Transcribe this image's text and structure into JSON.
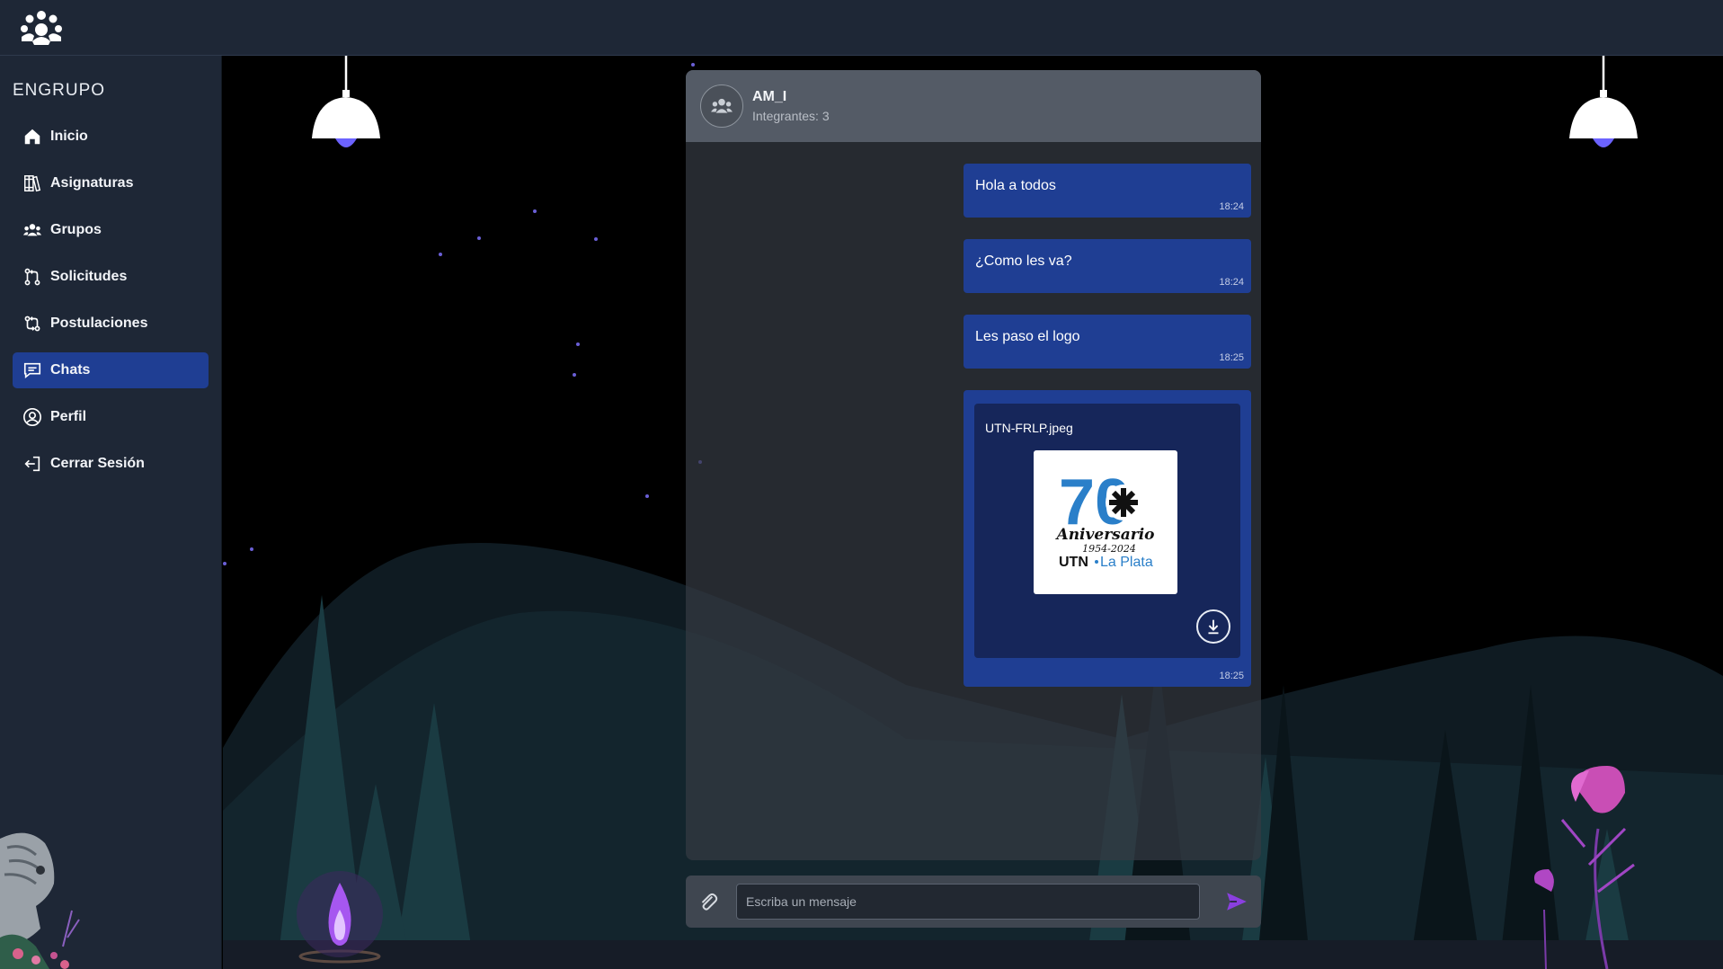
{
  "app": {
    "brand": "ENGRUPO"
  },
  "sidebar": {
    "items": [
      {
        "label": "Inicio",
        "icon": "home-icon"
      },
      {
        "label": "Asignaturas",
        "icon": "books-icon"
      },
      {
        "label": "Grupos",
        "icon": "users-icon"
      },
      {
        "label": "Solicitudes",
        "icon": "git-pull-request-icon"
      },
      {
        "label": "Postulaciones",
        "icon": "git-compare-icon"
      },
      {
        "label": "Chats",
        "icon": "message-icon",
        "active": true
      },
      {
        "label": "Perfil",
        "icon": "user-circle-icon"
      },
      {
        "label": "Cerrar Sesión",
        "icon": "logout-icon"
      }
    ]
  },
  "chat": {
    "name": "AM_I",
    "members": "Integrantes: 3",
    "messages": [
      {
        "text": "Hola a todos",
        "time": "18:24"
      },
      {
        "text": "¿Como les va?",
        "time": "18:24"
      },
      {
        "text": "Les paso el logo",
        "time": "18:25"
      }
    ],
    "file_message": {
      "file_name": "UTN-FRLP.jpeg",
      "time": "18:25",
      "logo_text": {
        "number": "70",
        "line1": "Aniversario",
        "line2": "1954-2024",
        "brand_a": "UTN",
        "brand_b": "La Plata"
      }
    }
  },
  "composer": {
    "placeholder": "Escriba un mensaje"
  },
  "colors": {
    "accent": "#1f3e93",
    "sidebar": "#1e2736",
    "send": "#8a3fe0"
  }
}
